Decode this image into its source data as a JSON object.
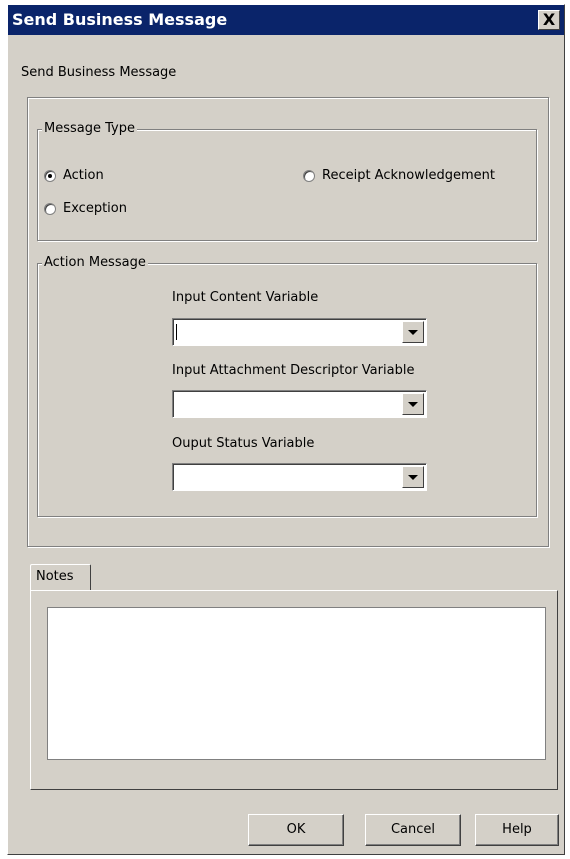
{
  "window": {
    "title": "Send Business Message",
    "close_glyph": "X"
  },
  "header": {
    "subtitle": "Send Business Message"
  },
  "message_type": {
    "legend": "Message Type",
    "options": [
      {
        "label": "Action",
        "checked": true
      },
      {
        "label": "Receipt Acknowledgement",
        "checked": false
      },
      {
        "label": "Exception",
        "checked": false
      }
    ]
  },
  "action_message": {
    "legend": "Action Message",
    "fields": [
      {
        "label": "Input Content Variable",
        "value": ""
      },
      {
        "label": "Input Attachment Descriptor Variable",
        "value": ""
      },
      {
        "label": "Ouput Status Variable",
        "value": ""
      }
    ]
  },
  "notes": {
    "tab_label": "Notes",
    "value": ""
  },
  "buttons": {
    "ok": "OK",
    "cancel": "Cancel",
    "help": "Help"
  },
  "colors": {
    "title_bar": "#0a246a",
    "dialog_bg": "#d4d0c8"
  },
  "icons": {
    "close": "close-icon",
    "dropdown": "chevron-down-icon"
  }
}
